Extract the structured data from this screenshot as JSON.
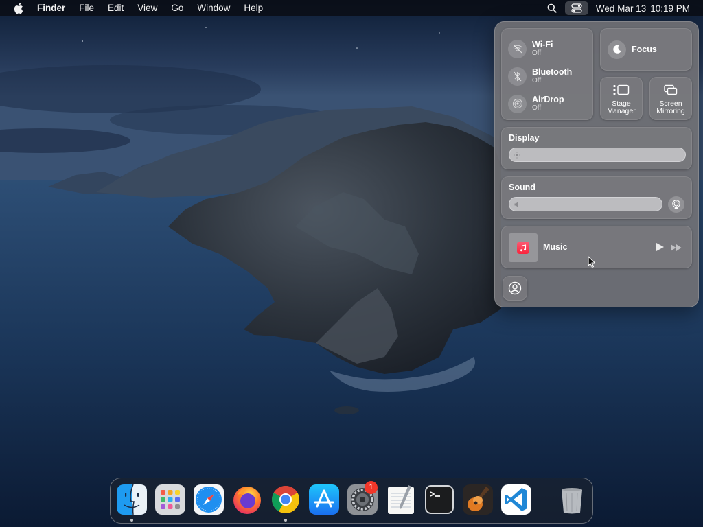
{
  "menubar": {
    "app_name": "Finder",
    "menus": [
      "File",
      "Edit",
      "View",
      "Go",
      "Window",
      "Help"
    ],
    "date": "Wed Mar 13",
    "time": "10:19 PM"
  },
  "control_center": {
    "wifi": {
      "title": "Wi-Fi",
      "status": "Off"
    },
    "bluetooth": {
      "title": "Bluetooth",
      "status": "Off"
    },
    "airdrop": {
      "title": "AirDrop",
      "status": "Off"
    },
    "focus": {
      "label": "Focus"
    },
    "stage_manager": {
      "label_line1": "Stage",
      "label_line2": "Manager"
    },
    "screen_mirroring": {
      "label_line1": "Screen",
      "label_line2": "Mirroring"
    },
    "display": {
      "heading": "Display",
      "brightness": 0
    },
    "sound": {
      "heading": "Sound",
      "volume": 0
    },
    "now_playing": {
      "app": "Music"
    }
  },
  "dock": {
    "items": [
      {
        "name": "Finder",
        "running": true
      },
      {
        "name": "Launchpad",
        "running": false
      },
      {
        "name": "Safari",
        "running": false
      },
      {
        "name": "Firefox",
        "running": false
      },
      {
        "name": "Google Chrome",
        "running": true
      },
      {
        "name": "App Store",
        "running": false
      },
      {
        "name": "System Settings",
        "running": false,
        "badge": "1"
      },
      {
        "name": "TextEdit",
        "running": false
      },
      {
        "name": "Terminal",
        "running": false
      },
      {
        "name": "GarageBand",
        "running": false
      },
      {
        "name": "Visual Studio Code",
        "running": false
      },
      {
        "name": "Trash",
        "running": false
      }
    ]
  },
  "colors": {
    "menubar_bg": "#0a0e16",
    "control_center_bg": "#707074",
    "badge": "#f2372a"
  }
}
